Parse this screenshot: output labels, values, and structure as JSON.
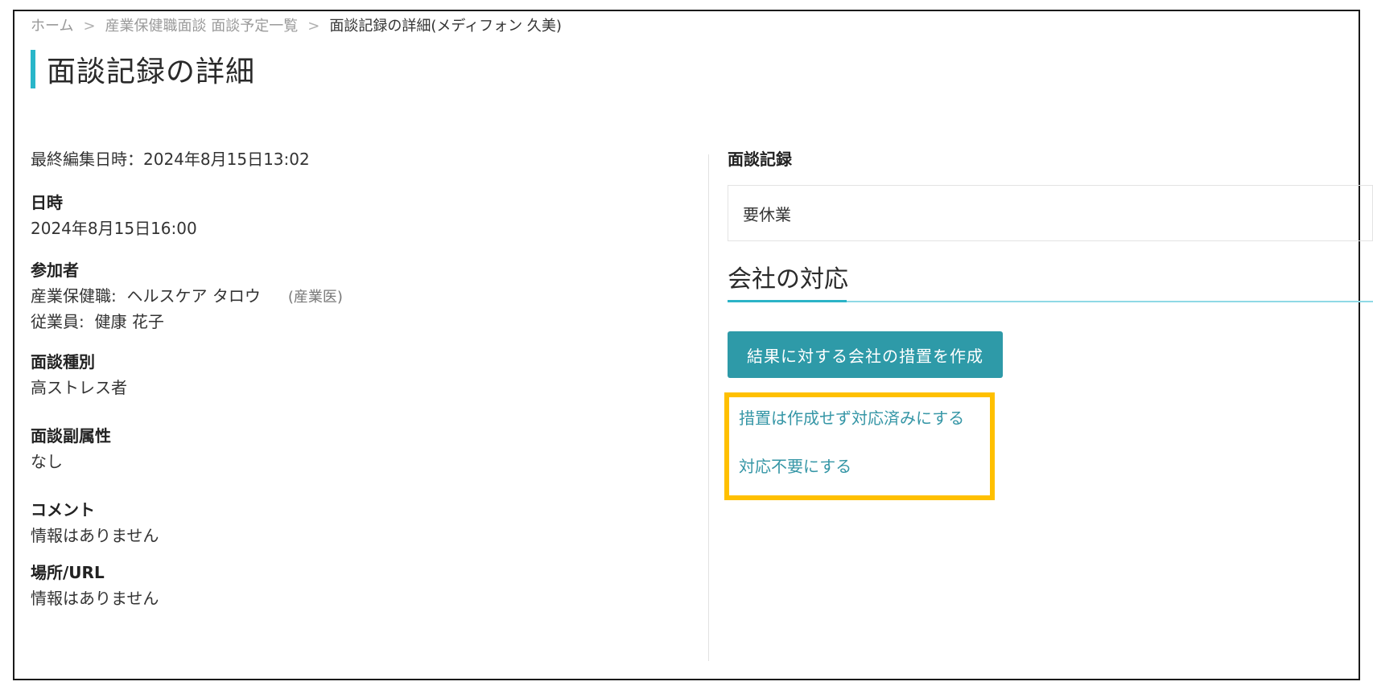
{
  "breadcrumb": {
    "items": [
      "ホーム",
      "産業保健職面談 面談予定一覧",
      "面談記録の詳細(メディフォン 久美)"
    ],
    "separator": ">"
  },
  "page": {
    "title": "面談記録の詳細"
  },
  "details": {
    "last_edited": "最終編集日時：2024年8月15日13:02",
    "datetime_label": "日時",
    "datetime_value": "2024年8月15日16:00",
    "participants_label": "参加者",
    "participant_staff_role": "産業保健職:",
    "participant_staff_name": "ヘルスケア タロウ",
    "participant_staff_title": "(産業医)",
    "participant_employee_role": "従業員:",
    "participant_employee_name": "健康 花子",
    "type_label": "面談種別",
    "type_value": "高ストレス者",
    "subattr_label": "面談副属性",
    "subattr_value": "なし",
    "comment_label": "コメント",
    "comment_value": "情報はありません",
    "place_label": "場所/URL",
    "place_value": "情報はありません"
  },
  "record": {
    "label": "面談記録",
    "value": "要休業"
  },
  "company_response": {
    "heading": "会社の対応",
    "create_button": "結果に対する会社の措置を作成",
    "link_done_without_measure": "措置は作成せず対応済みにする",
    "link_not_required": "対応不要にする"
  },
  "colors": {
    "accent": "#29b6c9",
    "button": "#2e9aa8",
    "link": "#3596a6",
    "highlight": "#ffc000"
  }
}
